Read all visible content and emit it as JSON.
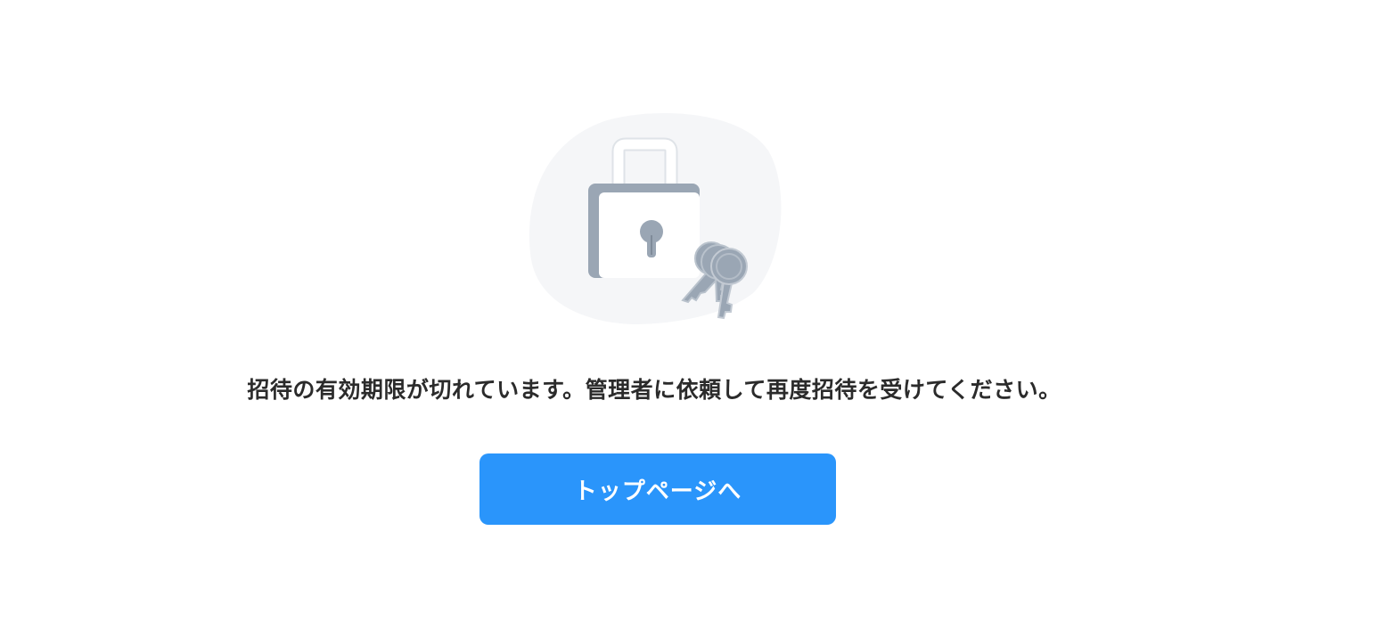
{
  "illustration": {
    "icon": "lock-with-keys-icon",
    "colors": {
      "blob": "#f5f6f8",
      "lock_body": "#ffffff",
      "lock_shade": "#9aa6b4",
      "keys": "#9aa6b4"
    }
  },
  "message": {
    "text": "招待の有効期限が切れています。管理者に依頼して再度招待を受けてください。"
  },
  "actions": {
    "top_page_label": "トップページへ",
    "button_color": "#2a95fb"
  }
}
